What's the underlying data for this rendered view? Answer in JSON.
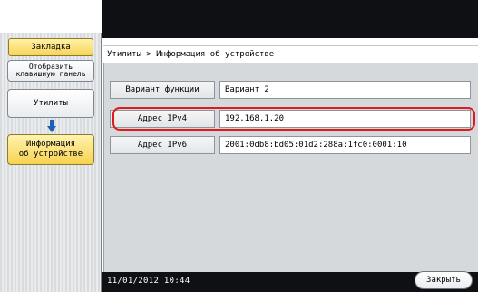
{
  "left_panel": {
    "bookmark_label": "Закладка",
    "keypad_label": "Отобразить\nклавишную панель",
    "utilities_label": "Утилиты",
    "device_info_label": "Информация\nоб устройстве"
  },
  "header": {
    "breadcrumb": "Утилиты > Информация об устройстве"
  },
  "rows": [
    {
      "label": "Вариант функции",
      "value": "Вариант 2"
    },
    {
      "label": "Адрес IPv4",
      "value": "192.168.1.20"
    },
    {
      "label": "Адрес IPv6",
      "value": "2001:0db8:bd05:01d2:288a:1fc0:0001:10"
    }
  ],
  "footer": {
    "datetime": "11/01/2012   10:44",
    "close_label": "Закрыть"
  },
  "colors": {
    "highlight": "#e01a1a",
    "active_button": "#f7d24f",
    "background_dark": "#0f1014",
    "panel": "#d6d9dc"
  }
}
